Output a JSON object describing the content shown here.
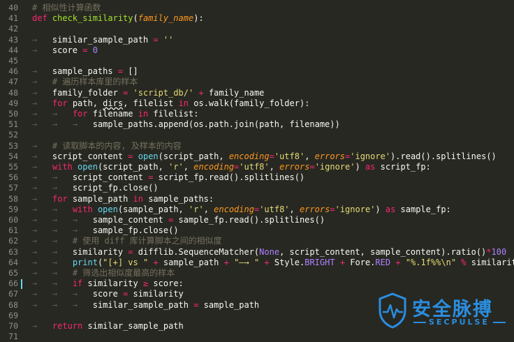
{
  "editor": {
    "language": "python",
    "theme_colors": {
      "background": "#272822",
      "keyword": "#f92672",
      "string": "#e6db74",
      "comment": "#75715e",
      "number": "#ae81ff",
      "function": "#a6e22e",
      "builtin": "#66d9ef",
      "parameter": "#fd971f",
      "plain": "#f8f8f2",
      "line_number": "#8f908a"
    },
    "modified_line": "66",
    "lines": [
      {
        "n": "40",
        "d": 0,
        "t": [
          [
            "c",
            "# 相似性计算函数"
          ]
        ]
      },
      {
        "n": "41",
        "d": 0,
        "t": [
          [
            "k",
            "def "
          ],
          [
            "f",
            "check_similarity"
          ],
          [
            "pl",
            "("
          ],
          [
            "p",
            "family_name"
          ],
          [
            "pl",
            "):"
          ]
        ]
      },
      {
        "n": "42",
        "d": 0,
        "t": []
      },
      {
        "n": "43",
        "d": 1,
        "t": [
          [
            "pl",
            "similar_sample_path "
          ],
          [
            "k",
            "="
          ],
          [
            "pl",
            " "
          ],
          [
            "s",
            "''"
          ]
        ]
      },
      {
        "n": "44",
        "d": 1,
        "t": [
          [
            "pl",
            "score "
          ],
          [
            "k",
            "="
          ],
          [
            "pl",
            " "
          ],
          [
            "n",
            "0"
          ]
        ]
      },
      {
        "n": "45",
        "d": 0,
        "t": []
      },
      {
        "n": "46",
        "d": 1,
        "t": [
          [
            "pl",
            "sample_paths "
          ],
          [
            "k",
            "="
          ],
          [
            "pl",
            " []"
          ]
        ]
      },
      {
        "n": "47",
        "d": 1,
        "t": [
          [
            "c",
            "# 遍历样本库里的样本"
          ]
        ]
      },
      {
        "n": "48",
        "d": 1,
        "t": [
          [
            "pl",
            "family_folder "
          ],
          [
            "k",
            "="
          ],
          [
            "pl",
            " "
          ],
          [
            "s",
            "'script_db/'"
          ],
          [
            "pl",
            " "
          ],
          [
            "k",
            "+"
          ],
          [
            "pl",
            " family_name"
          ]
        ]
      },
      {
        "n": "49",
        "d": 1,
        "t": [
          [
            "k",
            "for"
          ],
          [
            "pl",
            " path, "
          ],
          [
            "wv",
            "dirs"
          ],
          [
            "pl",
            ", filelist "
          ],
          [
            "k",
            "in"
          ],
          [
            "pl",
            " os.walk(family_folder):"
          ]
        ]
      },
      {
        "n": "50",
        "d": 2,
        "t": [
          [
            "k",
            "for"
          ],
          [
            "pl",
            " filename "
          ],
          [
            "k",
            "in"
          ],
          [
            "pl",
            " filelist:"
          ]
        ]
      },
      {
        "n": "51",
        "d": 3,
        "t": [
          [
            "pl",
            "sample_paths.append(os.path.join(path, filename))"
          ]
        ]
      },
      {
        "n": "52",
        "d": 0,
        "t": []
      },
      {
        "n": "53",
        "d": 1,
        "t": [
          [
            "c",
            "# 读取脚本的内容, 及样本的内容"
          ]
        ]
      },
      {
        "n": "54",
        "d": 1,
        "t": [
          [
            "pl",
            "script_content "
          ],
          [
            "k",
            "="
          ],
          [
            "pl",
            " "
          ],
          [
            "b",
            "open"
          ],
          [
            "pl",
            "(script_path, "
          ],
          [
            "i",
            "encoding"
          ],
          [
            "k",
            "="
          ],
          [
            "s",
            "'utf8'"
          ],
          [
            "pl",
            ", "
          ],
          [
            "i",
            "errors"
          ],
          [
            "k",
            "="
          ],
          [
            "s",
            "'ignore'"
          ],
          [
            "pl",
            ").read().splitlines()"
          ]
        ]
      },
      {
        "n": "55",
        "d": 1,
        "t": [
          [
            "k",
            "with"
          ],
          [
            "pl",
            " "
          ],
          [
            "b",
            "open"
          ],
          [
            "pl",
            "(script_path, "
          ],
          [
            "s",
            "'r'"
          ],
          [
            "pl",
            ", "
          ],
          [
            "i",
            "encoding"
          ],
          [
            "k",
            "="
          ],
          [
            "s",
            "'utf8'"
          ],
          [
            "pl",
            ", "
          ],
          [
            "i",
            "errors"
          ],
          [
            "k",
            "="
          ],
          [
            "s",
            "'ignore'"
          ],
          [
            "pl",
            ") "
          ],
          [
            "k",
            "as"
          ],
          [
            "pl",
            " script_fp:"
          ]
        ]
      },
      {
        "n": "56",
        "d": 2,
        "t": [
          [
            "pl",
            "script_content "
          ],
          [
            "k",
            "="
          ],
          [
            "pl",
            " script_fp.read().splitlines()"
          ]
        ]
      },
      {
        "n": "57",
        "d": 2,
        "t": [
          [
            "pl",
            "script_fp.close()"
          ]
        ]
      },
      {
        "n": "58",
        "d": 1,
        "t": [
          [
            "k",
            "for"
          ],
          [
            "pl",
            " sample_path "
          ],
          [
            "k",
            "in"
          ],
          [
            "pl",
            " sample_paths:"
          ]
        ]
      },
      {
        "n": "59",
        "d": 2,
        "t": [
          [
            "k",
            "with"
          ],
          [
            "pl",
            " "
          ],
          [
            "b",
            "open"
          ],
          [
            "pl",
            "(sample_path, "
          ],
          [
            "s",
            "'r'"
          ],
          [
            "pl",
            ", "
          ],
          [
            "i",
            "encoding"
          ],
          [
            "k",
            "="
          ],
          [
            "s",
            "'utf8'"
          ],
          [
            "pl",
            ", "
          ],
          [
            "i",
            "errors"
          ],
          [
            "k",
            "="
          ],
          [
            "s",
            "'ignore'"
          ],
          [
            "pl",
            ") "
          ],
          [
            "k",
            "as"
          ],
          [
            "pl",
            " sample_fp:"
          ]
        ]
      },
      {
        "n": "60",
        "d": 3,
        "t": [
          [
            "pl",
            "sample_content "
          ],
          [
            "k",
            "="
          ],
          [
            "pl",
            " sample_fp.read().splitlines()"
          ]
        ]
      },
      {
        "n": "61",
        "d": 3,
        "t": [
          [
            "pl",
            "sample_fp.close()"
          ]
        ]
      },
      {
        "n": "62",
        "d": 2,
        "t": [
          [
            "c",
            "# 使用 diff 库计算脚本之间的相似度"
          ]
        ]
      },
      {
        "n": "63",
        "d": 2,
        "t": [
          [
            "pl",
            "similarity "
          ],
          [
            "k",
            "="
          ],
          [
            "pl",
            " difflib.SequenceMatcher("
          ],
          [
            "n",
            "None"
          ],
          [
            "pl",
            ", script_content, sample_content).ratio()"
          ],
          [
            "k",
            "*"
          ],
          [
            "n",
            "100"
          ]
        ]
      },
      {
        "n": "64",
        "d": 2,
        "t": [
          [
            "b",
            "print"
          ],
          [
            "pl",
            "("
          ],
          [
            "s",
            "\"[+] vs \""
          ],
          [
            "pl",
            " "
          ],
          [
            "k",
            "+"
          ],
          [
            "pl",
            " sample_path "
          ],
          [
            "k",
            "+"
          ],
          [
            "pl",
            " "
          ],
          [
            "s",
            "\"—→ \""
          ],
          [
            "pl",
            " "
          ],
          [
            "k",
            "+"
          ],
          [
            "pl",
            " Style."
          ],
          [
            "n",
            "BRIGHT"
          ],
          [
            "pl",
            " "
          ],
          [
            "k",
            "+"
          ],
          [
            "pl",
            " Fore."
          ],
          [
            "n",
            "RED"
          ],
          [
            "pl",
            " "
          ],
          [
            "k",
            "+"
          ],
          [
            "pl",
            " "
          ],
          [
            "s",
            "\"%.1f%%\\n\""
          ],
          [
            "pl",
            " "
          ],
          [
            "k",
            "%"
          ],
          [
            "pl",
            " similarity)"
          ]
        ]
      },
      {
        "n": "65",
        "d": 2,
        "t": [
          [
            "c",
            "# 筛选出相似度最高的样本"
          ]
        ]
      },
      {
        "n": "66",
        "d": 2,
        "t": [
          [
            "k",
            "if"
          ],
          [
            "pl",
            " similarity "
          ],
          [
            "k",
            "≥"
          ],
          [
            "pl",
            " score:"
          ]
        ]
      },
      {
        "n": "67",
        "d": 3,
        "t": [
          [
            "pl",
            "score "
          ],
          [
            "k",
            "="
          ],
          [
            "pl",
            " similarity"
          ]
        ]
      },
      {
        "n": "68",
        "d": 3,
        "t": [
          [
            "pl",
            "similar_sample_path "
          ],
          [
            "k",
            "="
          ],
          [
            "pl",
            " sample_path"
          ]
        ]
      },
      {
        "n": "69",
        "d": 0,
        "t": []
      },
      {
        "n": "70",
        "d": 1,
        "t": [
          [
            "k",
            "return"
          ],
          [
            "pl",
            " similar_sample_path"
          ]
        ]
      },
      {
        "n": "71",
        "d": 0,
        "t": []
      }
    ]
  },
  "watermark": {
    "name_cn": "安全脉搏",
    "name_en": "SECPULSE",
    "icon": "shield-pulse-icon",
    "color": "#2a8ee0"
  }
}
